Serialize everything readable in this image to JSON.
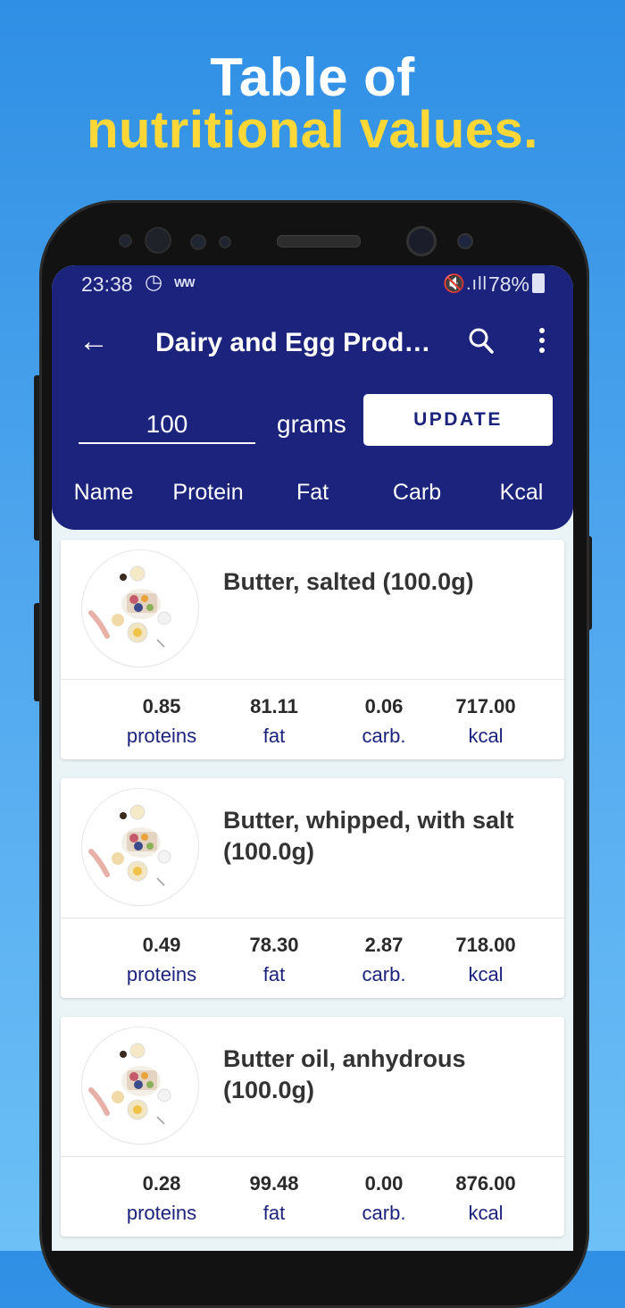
{
  "promo": {
    "line1": "Table of",
    "line2": "nutritional values."
  },
  "status_bar": {
    "time": "23:38",
    "battery": "78%"
  },
  "toolbar": {
    "title": "Dairy and Egg Products"
  },
  "amount": {
    "value": "100",
    "unit_label": "grams",
    "update_label": "UPDATE"
  },
  "columns": [
    "Name",
    "Protein",
    "Fat",
    "Carb",
    "Kcal"
  ],
  "unit_labels": {
    "protein": "proteins",
    "fat": "fat",
    "carb": "carb.",
    "kcal": "kcal"
  },
  "foods": [
    {
      "name": "Butter, salted (100.0g)",
      "protein": "0.85",
      "fat": "81.11",
      "carb": "0.06",
      "kcal": "717.00"
    },
    {
      "name": "Butter, whipped, with salt (100.0g)",
      "protein": "0.49",
      "fat": "78.30",
      "carb": "2.87",
      "kcal": "718.00"
    },
    {
      "name": "Butter oil, anhydrous (100.0g)",
      "protein": "0.28",
      "fat": "99.48",
      "carb": "0.00",
      "kcal": "876.00"
    }
  ],
  "colors": {
    "appbar": "#1b237c",
    "accent_text": "#1b237c",
    "headline_yellow": "#ffd837"
  }
}
